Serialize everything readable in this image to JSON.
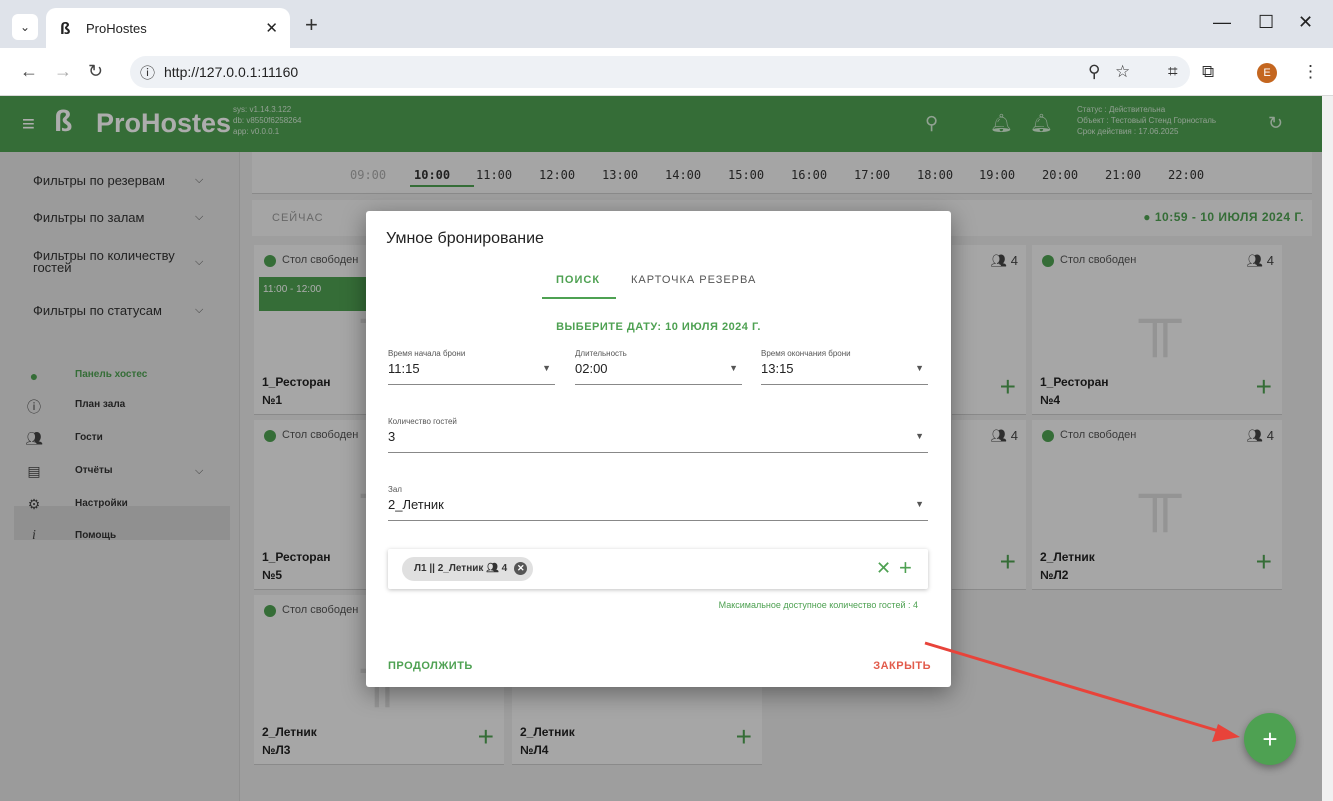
{
  "browser": {
    "tab_title": "ProHostes",
    "url": "http://127.0.0.1:11160",
    "profile_initial": "E"
  },
  "header": {
    "logo": "ProHostes",
    "version_lines": [
      "sys: v1.14.3.122",
      "db: v8550f6258264",
      "app: v0.0.0.1"
    ],
    "status_lines": [
      "Статус : Действительна",
      "Объект : Тестовый Стенд Горносталь",
      "Срок действия : 17.06.2025"
    ]
  },
  "sidebar": {
    "filters": [
      "Фильтры по резервам",
      "Фильтры по залам",
      "Фильтры по количеству гостей",
      "Фильтры по статусам"
    ],
    "nav": [
      "Панель хостес",
      "План зала",
      "Гости",
      "Отчёты",
      "Настройки",
      "Помощь"
    ]
  },
  "timeline": {
    "times": [
      "09:00",
      "10:00",
      "11:00",
      "12:00",
      "13:00",
      "14:00",
      "15:00",
      "16:00",
      "17:00",
      "18:00",
      "19:00",
      "20:00",
      "21:00",
      "22:00"
    ],
    "now_label": "СЕЙЧАС",
    "now_date": "10:59 - 10 ИЮЛЯ 2024 Г."
  },
  "cards": [
    {
      "status": "Стол свободен",
      "hall": "1_Ресторан",
      "num": "№1",
      "reservation": "11:00 - 12:00"
    },
    {
      "status": "Стол свободен",
      "guests": "4",
      "hall": "1_Ресторан",
      "num": "№4"
    },
    {
      "status": "Стол свободен",
      "hall": "1_Ресторан",
      "num": "№5"
    },
    {
      "status": "Стол свободен",
      "guests": "4",
      "hall": "2_Летник",
      "num": "№Л2"
    },
    {
      "status": "Стол свободен",
      "hall": "2_Летник",
      "num": "№Л3"
    },
    {
      "hall": "2_Летник",
      "num": "№Л4"
    }
  ],
  "partial_guest_counts": [
    "4",
    "4"
  ],
  "dialog": {
    "title": "Умное бронирование",
    "tabs": [
      "ПОИСК",
      "КАРТОЧКА РЕЗЕРВА"
    ],
    "select_date": "ВЫБЕРИТЕ ДАТУ: 10 ИЮЛЯ 2024 Г.",
    "start_label": "Время начала брони",
    "start_value": "11:15",
    "duration_label": "Длительность",
    "duration_value": "02:00",
    "end_label": "Время окончания брони",
    "end_value": "13:15",
    "guests_label": "Количество гостей",
    "guests_value": "3",
    "hall_label": "Зал",
    "hall_value": "2_Летник",
    "chip": "Л1 || 2_Летник",
    "chip_guests": "4",
    "max_guests": "Максимальное доступное количество гостей : 4",
    "continue": "ПРОДОЛЖИТЬ",
    "close": "ЗАКРЫТЬ"
  },
  "colors": {
    "brand": "#4ea152",
    "danger": "#e25b4b"
  }
}
